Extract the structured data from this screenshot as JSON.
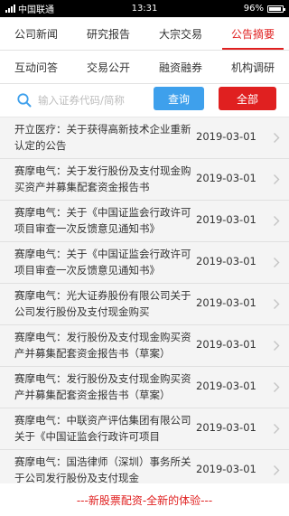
{
  "status_bar": {
    "carrier": "中国联通",
    "time": "13:31",
    "battery_text": "96%",
    "battery_level": 0.96
  },
  "tabs": {
    "row1": [
      {
        "label": "公司新闻",
        "active": false
      },
      {
        "label": "研究报告",
        "active": false
      },
      {
        "label": "大宗交易",
        "active": false
      },
      {
        "label": "公告摘要",
        "active": true
      }
    ],
    "row2": [
      {
        "label": "互动问答",
        "active": false
      },
      {
        "label": "交易公开",
        "active": false
      },
      {
        "label": "融资融券",
        "active": false
      },
      {
        "label": "机构调研",
        "active": false
      }
    ]
  },
  "search": {
    "placeholder": "输入证券代码/简称",
    "query_label": "查询",
    "all_label": "全部"
  },
  "announcements": [
    {
      "title": "开立医疗：关于获得高新技术企业重新认定的公告",
      "date": "2019-03-01"
    },
    {
      "title": "赛摩电气：关于发行股份及支付现金购买资产并募集配套资金报告书",
      "date": "2019-03-01"
    },
    {
      "title": "赛摩电气：关于《中国证监会行政许可项目审查一次反馈意见通知书》",
      "date": "2019-03-01"
    },
    {
      "title": "赛摩电气：关于《中国证监会行政许可项目审查一次反馈意见通知书》",
      "date": "2019-03-01"
    },
    {
      "title": "赛摩电气：光大证券股份有限公司关于公司发行股份及支付现金购买",
      "date": "2019-03-01"
    },
    {
      "title": "赛摩电气：发行股份及支付现金购买资产并募集配套资金报告书（草案）",
      "date": "2019-03-01"
    },
    {
      "title": "赛摩电气：发行股份及支付现金购买资产并募集配套资金报告书（草案）",
      "date": "2019-03-01"
    },
    {
      "title": "赛摩电气：中联资产评估集团有限公司关于《中国证监会行政许可项目",
      "date": "2019-03-01"
    },
    {
      "title": "赛摩电气：国浩律师（深圳）事务所关于公司发行股份及支付现金",
      "date": "2019-03-01"
    }
  ],
  "footer": {
    "text": "---新股票配资-全新的体验---"
  },
  "colors": {
    "accent_red": "#e02020",
    "query_blue": "#3ea0ec"
  },
  "icons": {
    "search": "search-icon",
    "row_arrow": "chevron-right-icon"
  }
}
